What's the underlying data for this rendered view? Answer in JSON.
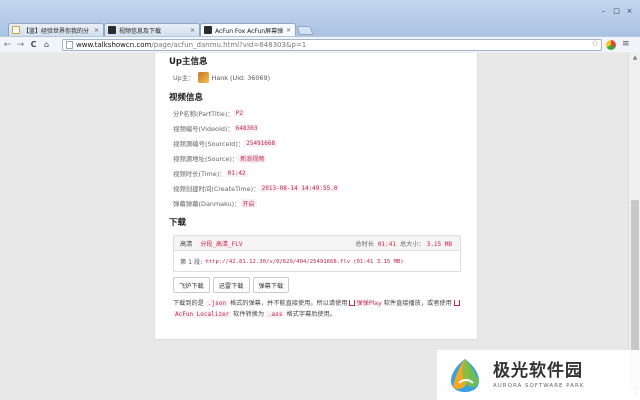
{
  "browser": {
    "tabs": [
      {
        "title": "【蓝】经验世界你我的分",
        "close": "×",
        "icon_color": "#c9a43b",
        "active": false
      },
      {
        "title": "视频信息及下载",
        "close": "×",
        "icon_color": "#2b2b2b",
        "active": false
      },
      {
        "title": "AcFun Fox AcFun屏幕弹",
        "close": "×",
        "icon_color": "#2b2b2b",
        "active": true
      }
    ],
    "window_buttons": {
      "minimize": "–",
      "maximize": "□",
      "close": "×"
    },
    "url_domain": "www.talkshowcn.com",
    "url_path": "/page/acfun_danmu.html?vid=648303&p=1",
    "nav": {
      "back": "←",
      "forward": "→",
      "reload": "C",
      "home": "⌂",
      "star": "☆",
      "menu": "≡"
    }
  },
  "uploader": {
    "section_title": "Up主信息",
    "label": "Up主：",
    "name": "Hank",
    "uid": "(Uid: 36069)"
  },
  "video": {
    "section_title": "视频信息",
    "rows": [
      {
        "label": "分P名称(PartTitle)：",
        "value": "P2"
      },
      {
        "label": "视频编号(VideoId)：",
        "value": "648303"
      },
      {
        "label": "视频源编号(SourceId)：",
        "value": "25491668"
      },
      {
        "label": "视频源地址(Source)：",
        "value": "新浪视频"
      },
      {
        "label": "视频时长(Time)：",
        "value": "01:42"
      },
      {
        "label": "视频创建时间(CreateTime)：",
        "value": "2013-08-14 14:49:55.0"
      },
      {
        "label": "弹幕弹幕(Danmaku)：",
        "value": "开启"
      }
    ]
  },
  "download": {
    "section_title": "下载",
    "quality": "高清",
    "format": "分段_高清_FLV",
    "total_label": "总时长",
    "total_time": "01:41",
    "size_label": "总大小：",
    "total_size": "3.15 MB",
    "part_label": "第 1 段:",
    "part_url": "http://42.81.12.30/v/0/629/404/25491668.flv",
    "part_meta": "(01:41  3.15 MB)",
    "buttons": [
      "飞炉下载",
      "迅雷下载",
      "弹幕下载"
    ]
  },
  "note": {
    "text1": "下载到的是",
    "code1": ".json",
    "text2": "格式的弹幕，并不能直接使用。所以请使用",
    "link1": "弹弹Play",
    "text3": "软件直接播放，或者使用",
    "link2": "AcFun Localizer",
    "text4": "软件转换为",
    "code2": ".ass",
    "text5": "格式字幕后使用。"
  },
  "watermark": {
    "cn": "极光软件园",
    "en": "AURORA SOFTWARE PARK"
  },
  "colors": {
    "accent_red": "#c7254e"
  }
}
